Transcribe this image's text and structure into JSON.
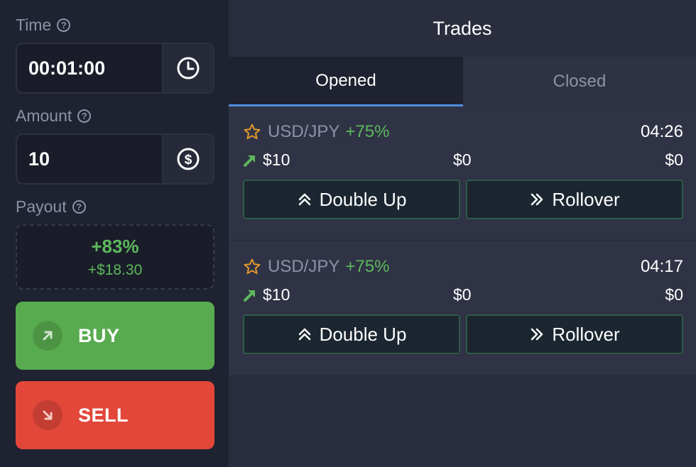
{
  "left": {
    "time": {
      "label": "Time",
      "value": "00:01:00",
      "icon": "clock-icon"
    },
    "amount": {
      "label": "Amount",
      "value": "10",
      "icon": "dollar-icon"
    },
    "payout": {
      "label": "Payout",
      "percent": "+83%",
      "amount": "+$18.30"
    },
    "buy_label": "BUY",
    "sell_label": "SELL"
  },
  "right": {
    "title": "Trades",
    "tabs": [
      {
        "label": "Opened",
        "active": true
      },
      {
        "label": "Closed",
        "active": false
      }
    ],
    "trades": [
      {
        "pair": "USD/JPY",
        "percent": "+75%",
        "timer": "04:26",
        "stake": "$10",
        "mid_value": "$0",
        "end_value": "$0",
        "double_up_label": "Double Up",
        "rollover_label": "Rollover"
      },
      {
        "pair": "USD/JPY",
        "percent": "+75%",
        "timer": "04:17",
        "stake": "$10",
        "mid_value": "$0",
        "end_value": "$0",
        "double_up_label": "Double Up",
        "rollover_label": "Rollover"
      }
    ]
  },
  "colors": {
    "buy": "#58ab4f",
    "sell": "#e2473a",
    "positive": "#5cb85c",
    "star": "#e39a2c",
    "tab_indicator": "#4f8ee0"
  }
}
